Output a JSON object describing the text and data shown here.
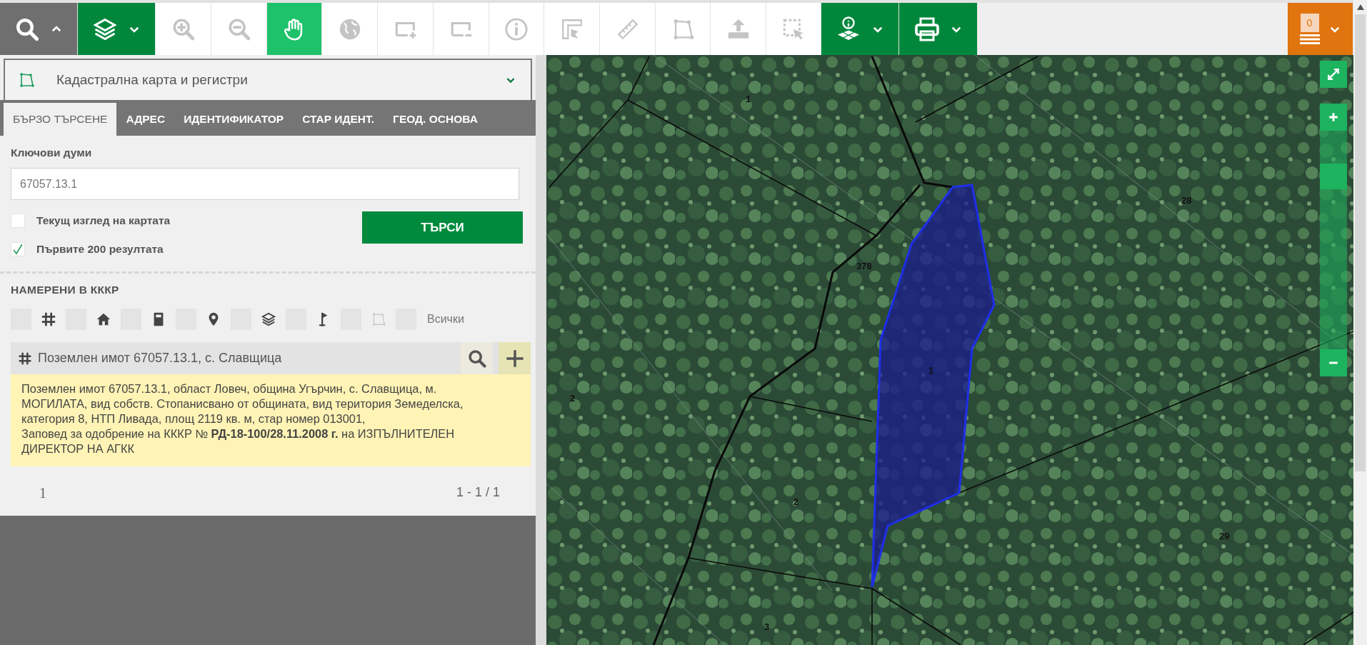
{
  "toolbar": {
    "tools": [
      {
        "kind": "menu",
        "selected": false
      },
      {
        "kind": "menu",
        "selected": false
      },
      {
        "kind": "tool",
        "selected": false
      },
      {
        "kind": "tool",
        "selected": false
      },
      {
        "kind": "tool",
        "selected": true
      },
      {
        "kind": "tool",
        "selected": false
      },
      {
        "kind": "tool",
        "selected": false
      },
      {
        "kind": "tool",
        "selected": false
      },
      {
        "kind": "tool",
        "selected": false
      },
      {
        "kind": "tool",
        "selected": false
      },
      {
        "kind": "tool",
        "selected": false
      },
      {
        "kind": "tool",
        "selected": false
      },
      {
        "kind": "tool",
        "selected": false
      },
      {
        "kind": "tool",
        "selected": false
      },
      {
        "kind": "menu",
        "selected": false
      },
      {
        "kind": "menu",
        "selected": false
      }
    ],
    "notifications": {
      "count": "0"
    }
  },
  "side": {
    "layer_select": {
      "label": "Кадастрална карта и регистри"
    },
    "tabs": [
      {
        "label": "БЪРЗО ТЪРСЕНЕ",
        "selected": true
      },
      {
        "label": "АДРЕС",
        "selected": false
      },
      {
        "label": "ИДЕНТИФИКАТОР",
        "selected": false
      },
      {
        "label": "СТАР ИДЕНТ.",
        "selected": false
      },
      {
        "label": "ГЕОД. ОСНОВА",
        "selected": false
      }
    ],
    "search": {
      "label": "Ключови думи",
      "value": "67057.13.1",
      "options": [
        {
          "label": "Текущ изглед на картата",
          "checked": false
        },
        {
          "label": "Първите 200 резултата",
          "checked": true
        }
      ],
      "button": "ТЪРСИ"
    },
    "results": {
      "heading": "НАМЕРЕНИ В КККР",
      "filters": [
        {
          "checked": false
        },
        {
          "checked": false
        },
        {
          "checked": false
        },
        {
          "checked": false
        },
        {
          "checked": false
        },
        {
          "checked": false
        },
        {
          "checked": false
        }
      ],
      "all": {
        "label": "Всички",
        "checked": false
      },
      "items": [
        {
          "title": "Поземлен имот 67057.13.1, с. Славщица",
          "expanded": true,
          "description": "Поземлен имот 67057.13.1, област Ловеч, община Угърчин, с. Славщица, м. МОГИЛАТА, вид собств. Стопанисвано от общината, вид територия Земеделска, категория 8, НТП Ливада, площ 2119 кв. м, стар номер 013001,\nЗаповед за одобрение на КККР № **РД-18-100/28.11.2008 г.** на ИЗПЪЛНИТЕЛЕН ДИРЕКТОР НА АГКК"
        }
      ],
      "page": "1",
      "range": "1 - 1 / 1"
    }
  },
  "map": {
    "zoom": {
      "level": 0.83
    },
    "parcel_labels": [
      "1",
      "378",
      "28",
      "1",
      "2",
      "2",
      "29",
      "3"
    ]
  }
}
